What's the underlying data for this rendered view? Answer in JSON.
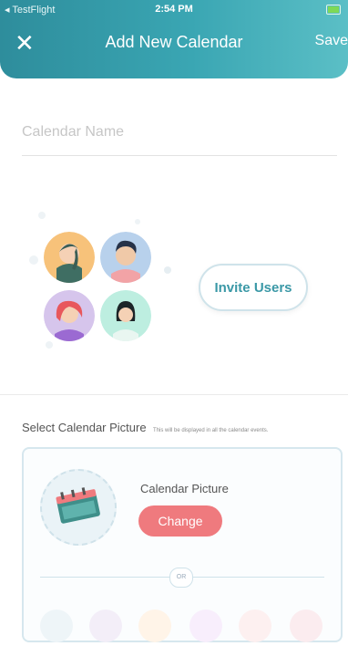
{
  "status_bar": {
    "back_app": "◂ TestFlight",
    "time": "2:54 PM",
    "battery_icon": "battery-icon"
  },
  "header": {
    "close_icon": "close-icon",
    "close_glyph": "✕",
    "title": "Add New Calendar",
    "save_label": "Save",
    "gradient_colors": [
      "#2e8d9c",
      "#3aa6b3",
      "#5bbfc6"
    ]
  },
  "calendar_name": {
    "value": "",
    "placeholder": "Calendar Name"
  },
  "invite": {
    "button_label": "Invite Users",
    "accent_color": "#3a98a6"
  },
  "picture": {
    "section_title": "Select Calendar Picture",
    "section_hint": "This will be displayed in all the calendar events.",
    "card_label": "Calendar Picture",
    "change_label": "Change",
    "or_label": "OR",
    "change_color": "#ef7a7e",
    "thumbnail_icons": [
      "calendar-icon",
      "cake-icon",
      "bowling-icon",
      "megaphone-icon",
      "flag-icon",
      "briefcase-icon"
    ]
  }
}
